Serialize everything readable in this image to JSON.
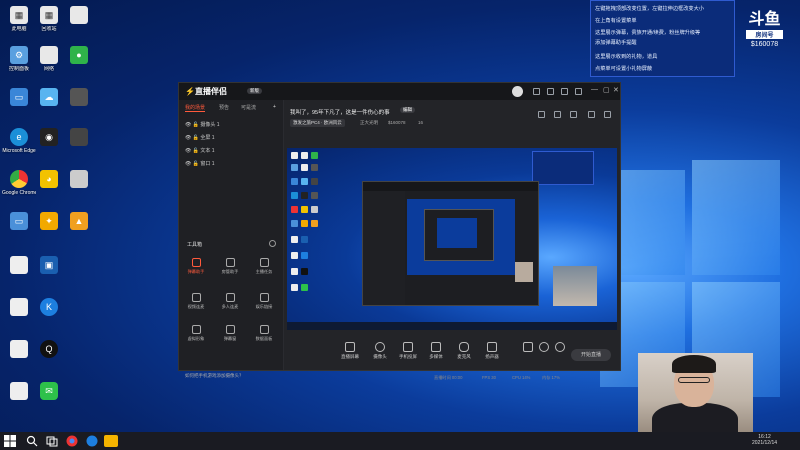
{
  "desktop": {
    "icons": [
      {
        "label": "此电脑"
      },
      {
        "label": "回收站"
      },
      {
        "label": ""
      },
      {
        "label": "控制面板"
      },
      {
        "label": "网络"
      },
      {
        "label": ""
      },
      {
        "label": ""
      },
      {
        "label": ""
      },
      {
        "label": ""
      },
      {
        "label": "Microsoft Edge"
      },
      {
        "label": ""
      },
      {
        "label": ""
      },
      {
        "label": "Google Chrome"
      },
      {
        "label": ""
      },
      {
        "label": ""
      },
      {
        "label": ""
      },
      {
        "label": ""
      },
      {
        "label": ""
      },
      {
        "label": ""
      },
      {
        "label": ""
      },
      {
        "label": ""
      },
      {
        "label": ""
      },
      {
        "label": ""
      },
      {
        "label": ""
      },
      {
        "label": ""
      },
      {
        "label": ""
      }
    ]
  },
  "chat_overlay": {
    "lines": [
      "左键拖拽顶部改变位置，左键拉伸边框改变大小",
      "在上角有设置菜单",
      "这里展示弹幕，贵族开通/续费，粉丝牌升级等",
      "添加弹幕助手提醒",
      "这里展示收到的礼物，道具",
      "点菜单可设置小礼物屏蔽"
    ]
  },
  "brand": {
    "logo": "斗鱼",
    "tag": "房间号",
    "room": "$160078"
  },
  "obs": {
    "app_name": "直播伴侣",
    "version": "新版",
    "tabs": [
      "我的场景",
      "预告",
      "可是流"
    ],
    "add": "+",
    "scenes": [
      "摄像头 1",
      "全屏 1",
      "文本 1",
      "窗口 1"
    ],
    "tools_title": "工具箱",
    "tools": [
      {
        "label": "弹幕助手",
        "hot": true
      },
      {
        "label": "房管助手",
        "hot": false
      },
      {
        "label": "主播任务",
        "hot": false
      },
      {
        "label": "视频连麦",
        "hot": false
      },
      {
        "label": "多人连麦",
        "hot": false
      },
      {
        "label": "娱乐链接",
        "hot": false
      },
      {
        "label": "虚拟形象",
        "hot": false
      },
      {
        "label": "弹幕窗",
        "hot": false
      },
      {
        "label": "数据面板",
        "hot": false
      }
    ],
    "hint": "如何把手机游戏添加摄像头？",
    "room_title": "我叫了，95年下凡了，这是一件伤心的事",
    "edit_label": "编辑",
    "chips": [
      "激发之旅PC4 · 欧洲风云"
    ],
    "meta": [
      "正大光明",
      "$160078",
      "16"
    ],
    "bottom_controls": [
      "直播屏幕",
      "摄像头",
      "手机投屏",
      "多媒体",
      "麦克风",
      "扬声器"
    ],
    "start_live": "开始直播",
    "status": [
      "直播时间 00:00",
      "FPS 30",
      "CPU 14%",
      "内存 17%"
    ],
    "top_status": "码率 0kbps  FPS 30  丢帧 0%  CPU 5%  内存 17%"
  },
  "taskbar": {
    "time": "16:12",
    "date": "2021/12/14"
  },
  "colors": {
    "accent": "#ff5a3c",
    "obs_bg": "#1b1c20",
    "desktop": "#0b3c9c"
  }
}
